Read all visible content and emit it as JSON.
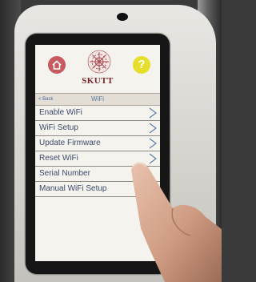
{
  "brand": {
    "name": "SKUTT"
  },
  "icons": {
    "home": "home-icon",
    "help": "help-icon",
    "back": "back-arrow-icon",
    "chevron": "chevron-right-icon",
    "logo": "skutt-logo-icon"
  },
  "colors": {
    "home_button": "#c65a5e",
    "help_button": "#e5de2a",
    "brand_text": "#7a2228",
    "menu_text": "#3a4a6a",
    "nav_accent": "#4a6b9a"
  },
  "help": {
    "symbol": "?"
  },
  "nav": {
    "back_label": "< Back",
    "title": "WiFi"
  },
  "menu": {
    "items": [
      {
        "label": "Enable WiFi",
        "has_chevron": true
      },
      {
        "label": "WiFi Setup",
        "has_chevron": true
      },
      {
        "label": "Update Firmware",
        "has_chevron": true
      },
      {
        "label": "Reset WiFi",
        "has_chevron": true
      },
      {
        "label": "Serial Number",
        "has_chevron": false
      },
      {
        "label": "Manual WiFi Setup",
        "has_chevron": false
      }
    ]
  }
}
